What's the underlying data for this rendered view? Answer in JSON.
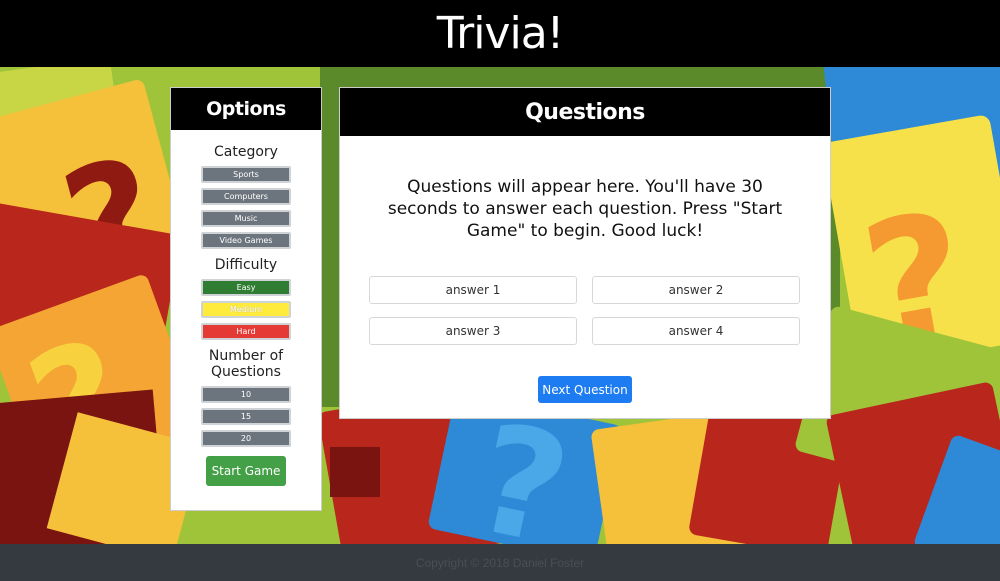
{
  "header": {
    "title": "Trivia!"
  },
  "options": {
    "title": "Options",
    "category_label": "Category",
    "categories": [
      "Sports",
      "Computers",
      "Music",
      "Video Games"
    ],
    "difficulty_label": "Difficulty",
    "difficulties": [
      "Easy",
      "Medium",
      "Hard"
    ],
    "count_label_line1": "Number of",
    "count_label_line2": "Questions",
    "counts": [
      "10",
      "15",
      "20"
    ],
    "start_label": "Start Game"
  },
  "questions": {
    "title": "Questions",
    "text": "Questions will appear here. You'll have 30 seconds to answer each question. Press \"Start Game\" to begin. Good luck!",
    "answers": [
      "answer 1",
      "answer 2",
      "answer 3",
      "answer 4"
    ],
    "next_label": "Next Question"
  },
  "footer": {
    "copyright": "Copyright © 2018 Daniel Foster"
  },
  "colors": {
    "accent_blue": "#1e7cf2",
    "easy_green": "#2e7d32",
    "medium_yellow": "#ffeb3b",
    "hard_red": "#e53935",
    "start_green": "#43a047"
  }
}
